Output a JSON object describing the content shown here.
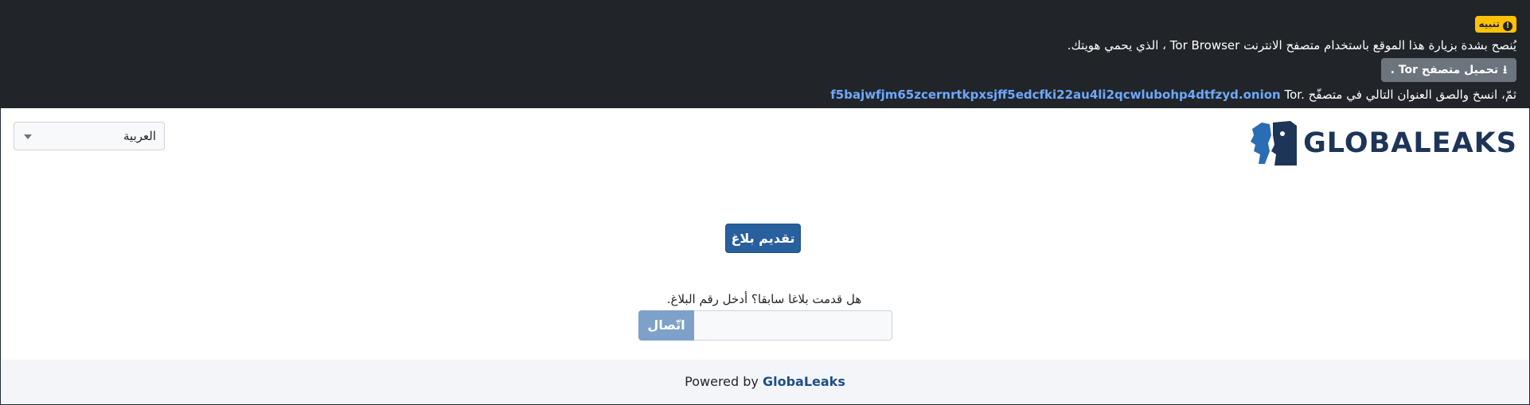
{
  "banner": {
    "badge_label": "تنبيه",
    "line1_before": "يُنصح بشدة بزيارة هذا الموقع باستخدام متصفح الانترنت",
    "line1_browser": "Tor Browser",
    "line1_after": "، الذي يحمي هويتك.",
    "download_button": "تحميل متصفح Tor .",
    "line3_before": "ثمّ، انسخ والصق العنوان التالي في متصفّح",
    "onion_address": "f5bajwfjm65zcernrtkpxsjff5edcfki22au4li2qcwlubohp4dtfzyd.onion",
    "line3_after": "Tor."
  },
  "header": {
    "logo_text": "GLOBALEAKS",
    "language_selected": "العربية"
  },
  "main": {
    "submit_button": "تقديم بلاغ",
    "receipt_question": "هل قدمت بلاغا سابقا؟ أدخل رقم البلاغ.",
    "receipt_value": "",
    "connect_button": "اتّصال"
  },
  "footer": {
    "powered_by": "Powered by",
    "brand": "GlobaLeaks"
  },
  "colors": {
    "banner_bg": "#212529",
    "warning": "#ffc107",
    "primary": "#285f9d",
    "link": "#6ea8fe",
    "logo": "#1d3557"
  },
  "icons": [
    "warning-icon",
    "download-icon",
    "caret-down-icon",
    "globaleaks-logo-icon"
  ]
}
